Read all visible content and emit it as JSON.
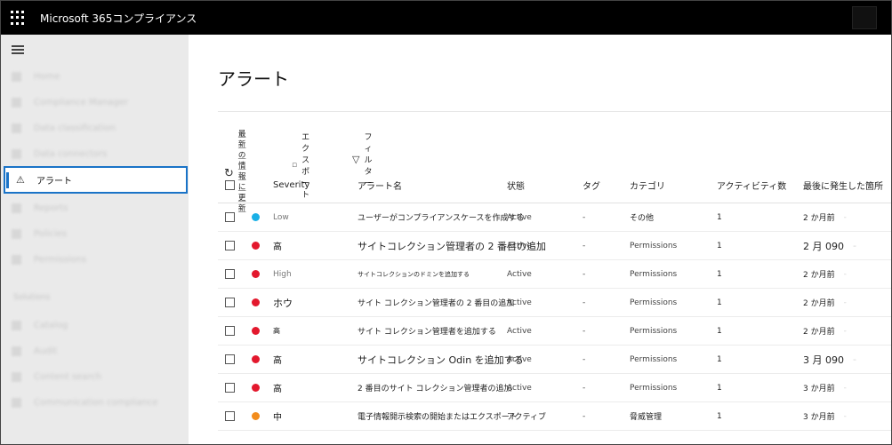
{
  "app": {
    "title": "Microsoft 365コンプライアンス"
  },
  "sidebar": {
    "blurred_items": [
      "Home",
      "Compliance Manager",
      "Data classification",
      "Data connectors"
    ],
    "active_item": {
      "label": "アラート",
      "icon": "warning-triangle-icon"
    },
    "blurred_items_after": [
      "Reports",
      "Policies",
      "Permissions"
    ],
    "section_label": "Solutions",
    "blurred_solutions": [
      "Catalog",
      "Audit",
      "Content search",
      "Communication compliance"
    ]
  },
  "page": {
    "title": "アラート"
  },
  "toolbar": {
    "refresh_label": "最新の情報に更新",
    "export_label": "エクスポート",
    "filter_label": "フィルター"
  },
  "table": {
    "columns": {
      "severity": "Severity",
      "name": "アラート名",
      "status": "状態",
      "tag": "タグ",
      "category": "カテゴリ",
      "activity": "アクティビティ数",
      "last": "最後に発生した箇所"
    },
    "rows": [
      {
        "dot_color": "#1ab0e6",
        "severity": "Low",
        "name": "ユーザーがコンプライアンスケースを作成する",
        "status": "Active",
        "tag": "-",
        "category": "その他",
        "activity": "1",
        "last": "2 か月前",
        "last_extra": "-"
      },
      {
        "dot_color": "#e3182d",
        "severity": "高",
        "name": "サイトコレクション管理者の 2 番目の追加",
        "status": "Active",
        "tag": "-",
        "category": "Permissions",
        "activity": "1",
        "last": "2 月 090",
        "last_extra": "-"
      },
      {
        "dot_color": "#e3182d",
        "severity": "High",
        "name": "サイトコレクションのドミンを追加する",
        "status": "Active",
        "tag": "-",
        "category": "Permissions",
        "activity": "1",
        "last": "2 か月前",
        "last_extra": "-"
      },
      {
        "dot_color": "#e3182d",
        "severity": "ホウ",
        "name": "サイト コレクション管理者の 2 番目の追加",
        "status": "Active",
        "tag": "-",
        "category": "Permissions",
        "activity": "1",
        "last": "2 か月前",
        "last_extra": "-"
      },
      {
        "dot_color": "#e3182d",
        "severity": "高",
        "name": "サイト コレクション管理者を追加する",
        "status": "Active",
        "tag": "-",
        "category": "Permissions",
        "activity": "1",
        "last": "2 か月前",
        "last_extra": "-"
      },
      {
        "dot_color": "#e3182d",
        "severity": "高",
        "name": "サイトコレクション Odin を追加する",
        "status": "Active",
        "tag": "-",
        "category": "Permissions",
        "activity": "1",
        "last": "3 月 090",
        "last_extra": "-"
      },
      {
        "dot_color": "#e3182d",
        "severity": "高",
        "name": "2 番目のサイト コレクション管理者の追加",
        "status": "Active",
        "tag": "-",
        "category": "Permissions",
        "activity": "1",
        "last": "3 か月前",
        "last_extra": "-"
      },
      {
        "dot_color": "#f28c1c",
        "severity": "中",
        "name": "電子情報開示検索の開始またはエクスポート",
        "status": "アクティブ",
        "tag": "-",
        "category": "脅威管理",
        "activity": "1",
        "last": "3 か月前",
        "last_extra": "-"
      }
    ]
  }
}
